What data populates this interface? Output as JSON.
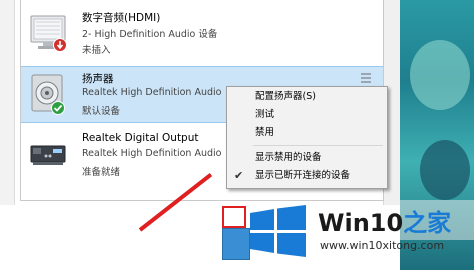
{
  "devices": [
    {
      "name": "数字音频(HDMI)",
      "description": "2- High Definition Audio 设备",
      "status": "未插入",
      "icon": "monitor-speaker-icon",
      "badge": "unplugged-down-arrow-icon"
    },
    {
      "name": "扬声器",
      "description": "Realtek High Definition Audio",
      "status": "默认设备",
      "icon": "speaker-icon",
      "badge": "default-check-icon"
    },
    {
      "name": "Realtek Digital Output",
      "description": "Realtek High Definition Audio",
      "status": "准备就绪",
      "icon": "digital-output-icon"
    }
  ],
  "context_menu": {
    "items": [
      {
        "label": "配置扬声器(S)",
        "checked": false
      },
      {
        "label": "测试",
        "checked": false
      },
      {
        "label": "禁用",
        "checked": false
      },
      {
        "label": "显示禁用的设备",
        "checked": false
      },
      {
        "label": "显示已断开连接的设备",
        "checked": true
      }
    ]
  },
  "watermark": {
    "title_main": "Win10",
    "title_accent": "之家",
    "url": "www.win10xitong.com"
  },
  "colors": {
    "selection": "#cce4f7",
    "menu_bg": "#f2f2f2",
    "highlight_red": "#e02020",
    "brand_blue": "#1a7bd6"
  }
}
